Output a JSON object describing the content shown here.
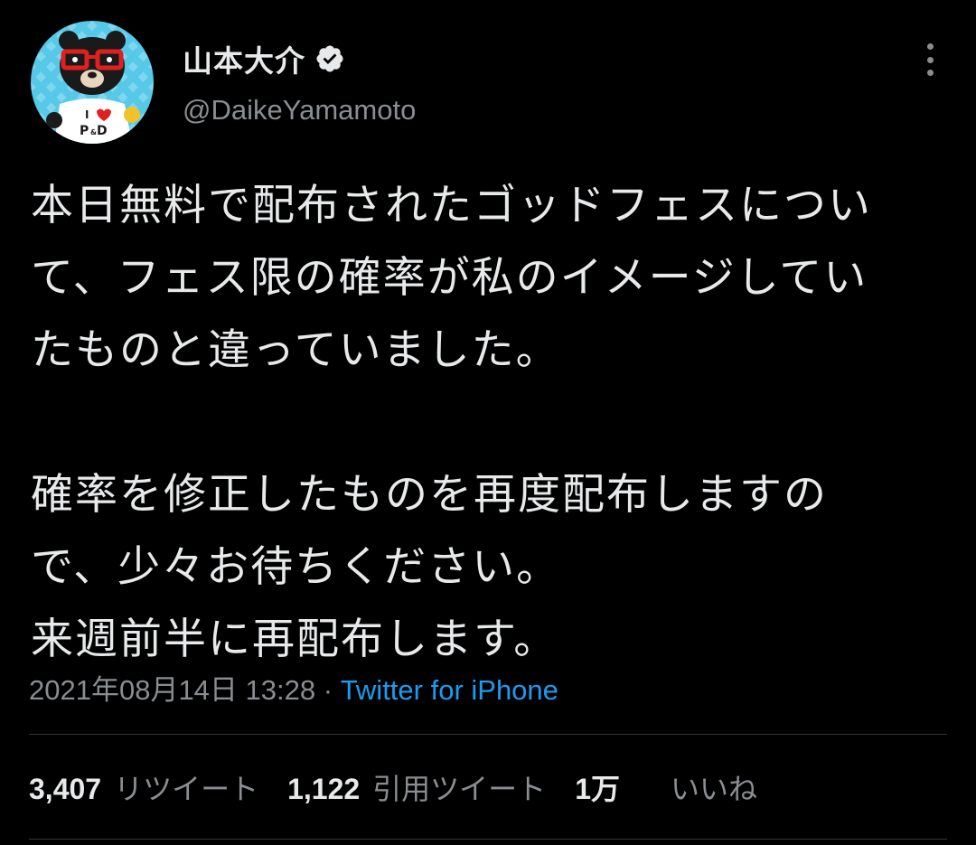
{
  "author": {
    "display_name": "山本大介",
    "handle": "@DaikeYamamoto",
    "verified": true,
    "avatar": {
      "icon": "bear-mascot-avatar",
      "shirt_text": "I ♥ P&D",
      "background": "#56c8e8"
    }
  },
  "tweet": {
    "lines": [
      "本日無料で配布されたゴッドフェスについ",
      "て、フェス限の確率が私のイメージしてい",
      "たものと違っていました。",
      "",
      "確率を修正したものを再度配布しますの",
      "で、少々お待ちください。",
      "来週前半に再配布します。"
    ]
  },
  "meta": {
    "timestamp": "2021年08月14日 13:28",
    "separator": " · ",
    "source": "Twitter for iPhone"
  },
  "stats": {
    "retweets": {
      "count": "3,407",
      "label": "リツイート"
    },
    "quotes": {
      "count": "1,122",
      "label": "引用ツイート"
    },
    "likes": {
      "count": "1万",
      "label": "いいね"
    }
  },
  "colors": {
    "background": "#000000",
    "text": "#e7e9ea",
    "secondary_text": "#8a8d91",
    "link": "#1d9bf0",
    "divider": "#2f3336"
  }
}
